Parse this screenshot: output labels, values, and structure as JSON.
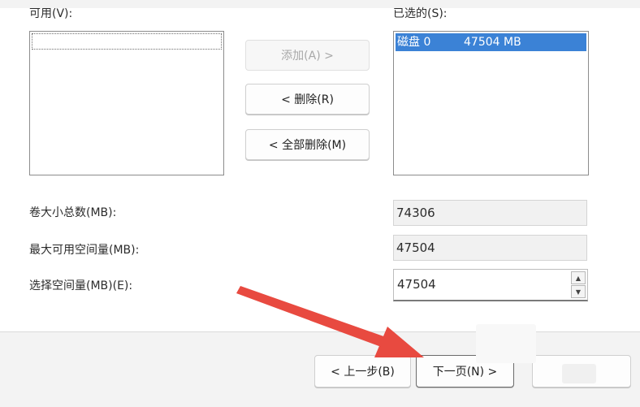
{
  "available_label": "可用(V):",
  "selected_label": "已选的(S):",
  "selected_items": [
    {
      "name": "磁盘 0",
      "size": "47504 MB"
    }
  ],
  "buttons": {
    "add": "添加(A) >",
    "remove": "< 删除(R)",
    "remove_all": "< 全部删除(M)",
    "back": "< 上一步(B)",
    "next": "下一页(N) >"
  },
  "fields": {
    "total_size_label": "卷大小总数(MB):",
    "total_size_value": "74306",
    "max_space_label": "最大可用空间量(MB):",
    "max_space_value": "47504",
    "select_space_label": "选择空间量(MB)(E):",
    "select_space_value": "47504"
  },
  "colors": {
    "selection": "#3b82d6",
    "arrow": "#e84a40"
  }
}
